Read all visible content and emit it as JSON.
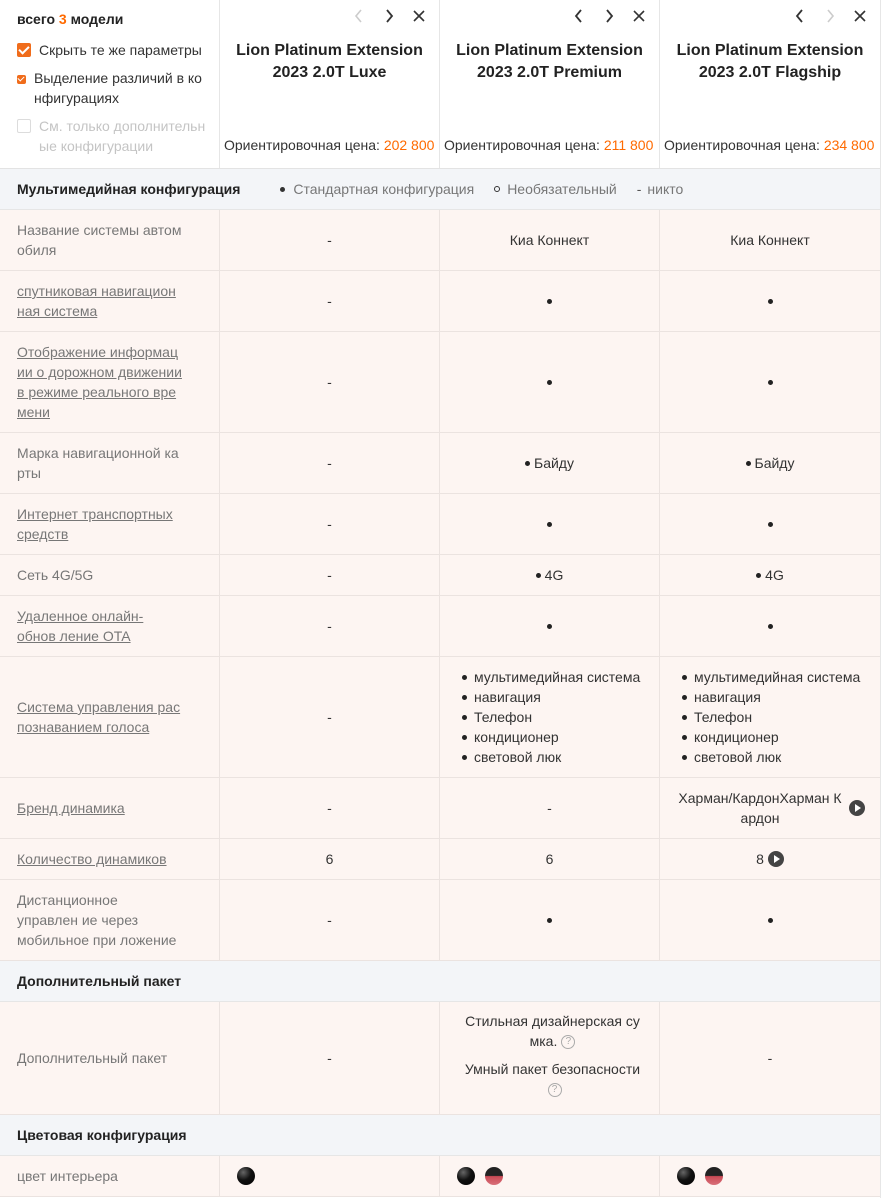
{
  "header": {
    "count_prefix": "всего",
    "count_num": "3",
    "count_suffix": "модели",
    "options": [
      {
        "label": "Скрыть те же параметры",
        "checked": true
      },
      {
        "label": "Выделение различий в ко нфигурациях",
        "checked": true
      },
      {
        "label": "См. только дополнительн ые конфигурации",
        "checked": false
      }
    ],
    "price_label": "Ориентировочная цена:",
    "models": [
      {
        "name_line1": "Lion Platinum Extension",
        "name_line2": "2023 2.0T Luxe",
        "price": "202 800"
      },
      {
        "name_line1": "Lion Platinum Extension",
        "name_line2": "2023 2.0T Premium",
        "price": "211 800"
      },
      {
        "name_line1": "Lion Platinum Extension",
        "name_line2": "2023 2.0T Flagship",
        "price": "234 800"
      }
    ]
  },
  "legend": {
    "standard": "Стандартная конфигурация",
    "optional": "Необязательный",
    "none": "никто"
  },
  "sections": {
    "multimedia": "Мультимедийная конфигурация",
    "extra": "Дополнительный пакет",
    "color": "Цветовая конфигурация"
  },
  "rows": {
    "r0": {
      "label": "Название системы автом обиля",
      "c1": "-",
      "c2": "Киа Коннект",
      "c3": "Киа Коннект"
    },
    "r1": {
      "label": "спутниковая навигацион ная система"
    },
    "r2": {
      "label": "Отображение информац ии о дорожном движении в режиме реального вре мени"
    },
    "r3": {
      "label": "Марка навигационной ка рты",
      "c1": "-",
      "c2": "Байду",
      "c3": "Байду"
    },
    "r4": {
      "label": "Интернет транспортных средств"
    },
    "r5": {
      "label": "Сеть 4G/5G",
      "c1": "-",
      "c2": "4G",
      "c3": "4G"
    },
    "r6": {
      "label": "Удаленное онлайн-обнов ление OTA"
    },
    "r7": {
      "label": "Система управления рас познаванием голоса",
      "c1": "-",
      "items": [
        "мультимедийная система",
        "навигация",
        "Телефон",
        "кондиционер",
        "световой люк"
      ]
    },
    "r8": {
      "label": "Бренд динамика",
      "c1": "-",
      "c2": "-",
      "c3": "Харман/КардонХарман К ардон"
    },
    "r9": {
      "label": "Количество динамиков",
      "c1": "6",
      "c2": "6",
      "c3": "8"
    },
    "r10": {
      "label": "Дистанционное управлен ие через мобильное при ложение"
    },
    "r11": {
      "label": "Дополнительный пакет",
      "c1": "-",
      "c2a": "Стильная дизайнерская су мка.",
      "c2b": "Умный пакет безопасности",
      "c3": "-"
    },
    "r12": {
      "label": "цвет интерьера"
    }
  },
  "dash": "-",
  "help_glyph": "?"
}
